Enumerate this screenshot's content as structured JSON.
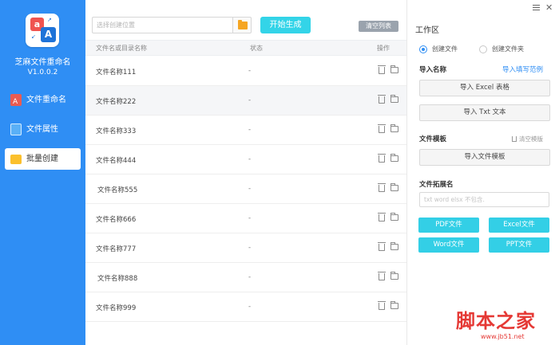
{
  "app": {
    "name": "芝麻文件重命名",
    "version": "V1.0.0.2",
    "logo_letters": [
      "a",
      "A"
    ]
  },
  "sidebar": {
    "items": [
      {
        "label": "文件重命名",
        "icon": "rename-icon",
        "active": false
      },
      {
        "label": "文件属性",
        "icon": "file-properties-icon",
        "active": false
      },
      {
        "label": "批量创建",
        "icon": "folder-icon",
        "active": true
      }
    ]
  },
  "toolbar": {
    "location_placeholder": "选择创建位置",
    "start_label": "开始生成",
    "clear_list_label": "清空列表"
  },
  "table": {
    "headers": {
      "name": "文件名或目录名称",
      "status": "状态",
      "actions": "操作"
    },
    "rows": [
      {
        "name": "文件名称111",
        "status": "-"
      },
      {
        "name": "文件名称222",
        "status": "-"
      },
      {
        "name": "文件名称333",
        "status": "-"
      },
      {
        "name": "文件名称444",
        "status": "-"
      },
      {
        "name": "文件名称555",
        "status": "-"
      },
      {
        "name": "文件名称666",
        "status": "-"
      },
      {
        "name": "文件名称777",
        "status": "-"
      },
      {
        "name": "文件名称888",
        "status": "-"
      },
      {
        "name": "文件名称999",
        "status": "-"
      }
    ]
  },
  "workspace": {
    "title": "工作区",
    "create_file_label": "创建文件",
    "create_folder_label": "创建文件夹",
    "selected_mode": "创建文件",
    "import_names_title": "导入名称",
    "import_example_link": "导入填写范例",
    "import_excel_label": "导入 Excel 表格",
    "import_txt_label": "导入 Txt 文本",
    "template_title": "文件模板",
    "clear_template_label": "清空模版",
    "import_template_label": "导入文件模板",
    "extension_title": "文件拓展名",
    "extension_placeholder": "txt word elsx 不包含.",
    "pdf_label": "PDF文件",
    "excel_label": "Excel文件",
    "word_label": "Word文件",
    "ppt_label": "PPT文件"
  },
  "watermark": {
    "text": "脚本之家",
    "sub": "www.jb51.net"
  },
  "colors": {
    "sidebar": "#2f8ef4",
    "accent_cyan": "#33d4e8",
    "link_blue": "#2f8ef4",
    "watermark_red": "#e53935"
  }
}
